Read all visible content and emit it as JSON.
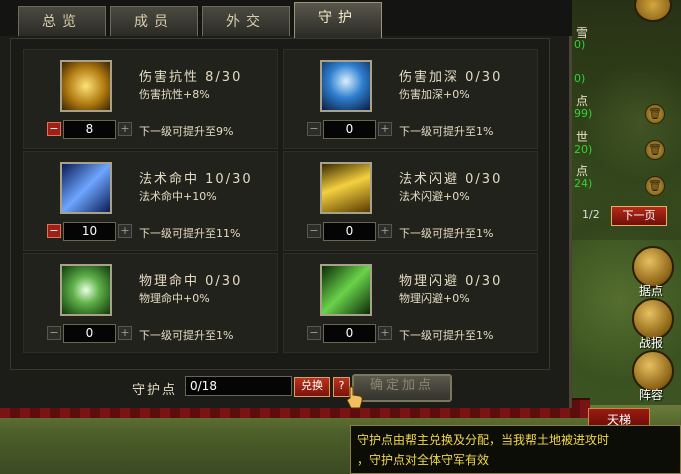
{
  "tabs": [
    "总览",
    "成员",
    "外交",
    "守护"
  ],
  "active_tab": 3,
  "skills": [
    {
      "name": "伤害抗性",
      "progress": "8/30",
      "desc": "伤害抗性+8%",
      "value": "8",
      "next": "下一级可提升至9%",
      "minus_active": true,
      "icon": "fist-icon"
    },
    {
      "name": "伤害加深",
      "progress": "0/30",
      "desc": "伤害加深+0%",
      "value": "0",
      "next": "下一级可提升至1%",
      "minus_active": false,
      "icon": "dragon-icon"
    },
    {
      "name": "法术命中",
      "progress": "10/30",
      "desc": "法术命中+10%",
      "value": "10",
      "next": "下一级可提升至11%",
      "minus_active": true,
      "icon": "arrows-icon"
    },
    {
      "name": "法术闪避",
      "progress": "0/30",
      "desc": "法术闪避+0%",
      "value": "0",
      "next": "下一级可提升至1%",
      "minus_active": false,
      "icon": "lightning-icon"
    },
    {
      "name": "物理命中",
      "progress": "0/30",
      "desc": "物理命中+0%",
      "value": "0",
      "next": "下一级可提升至1%",
      "minus_active": false,
      "icon": "vortex-icon"
    },
    {
      "name": "物理闪避",
      "progress": "0/30",
      "desc": "物理闪避+0%",
      "value": "0",
      "next": "下一级可提升至1%",
      "minus_active": false,
      "icon": "blade-icon"
    }
  ],
  "guard": {
    "label": "守护点",
    "value": "0/18",
    "exchange": "兑换",
    "help": "?",
    "confirm": "确定加点"
  },
  "tooltip": {
    "line1": "守护点由帮主兑换及分配，当我帮土地被进攻时",
    "line2": "，守护点对全体守军有效"
  },
  "right": {
    "entries": [
      {
        "t": "雪",
        "g": "0)"
      },
      {
        "t": "",
        "g": "0)"
      },
      {
        "t": "点",
        "g": "99)"
      },
      {
        "t": "世",
        "g": "20)"
      },
      {
        "t": "点",
        "g": "24)"
      }
    ],
    "page": "1/2",
    "next_page": "下一页",
    "buttons": [
      "据点",
      "战报",
      "阵容"
    ],
    "tian": "天梯"
  }
}
